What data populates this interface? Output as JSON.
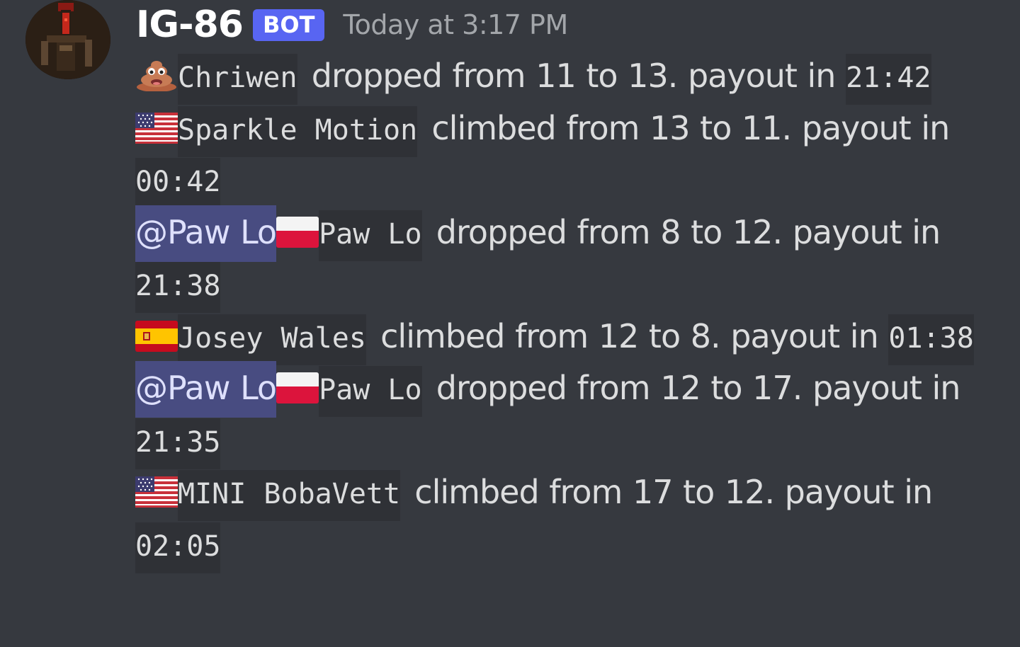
{
  "author": {
    "name": "IG-86",
    "bot_tag": "BOT",
    "timestamp": "Today at 3:17 PM",
    "avatar_icon": "droid-avatar"
  },
  "colors": {
    "background": "#36393f",
    "code_background": "#2f3136",
    "mention_background": "#484c81",
    "bot_tag": "#5865f2"
  },
  "messages": [
    {
      "emoji": "poop-emoji",
      "name": "Chriwen",
      "text": " dropped from 11 to 13. payout in ",
      "time": "21:42"
    },
    {
      "emoji": "us-flag-emoji",
      "name": "Sparkle Motion",
      "text": " climbed from 13 to 11. payout in ",
      "time": "00:42"
    },
    {
      "mention": "@Paw Lo",
      "emoji": "poland-flag-emoji",
      "name": "Paw Lo",
      "text": " dropped from 8 to 12. payout in ",
      "time": "21:38"
    },
    {
      "emoji": "spain-flag-emoji",
      "name": "Josey Wales",
      "text": " climbed from 12 to 8. payout in ",
      "time": "01:38"
    },
    {
      "mention": "@Paw Lo",
      "emoji": "poland-flag-emoji",
      "name": "Paw Lo",
      "text": " dropped from 12 to 17. payout in ",
      "time": "21:35"
    },
    {
      "emoji": "us-flag-emoji",
      "name": "MINI BobaVett",
      "text": " climbed from 17 to 12. payout in ",
      "time": "02:05"
    }
  ]
}
